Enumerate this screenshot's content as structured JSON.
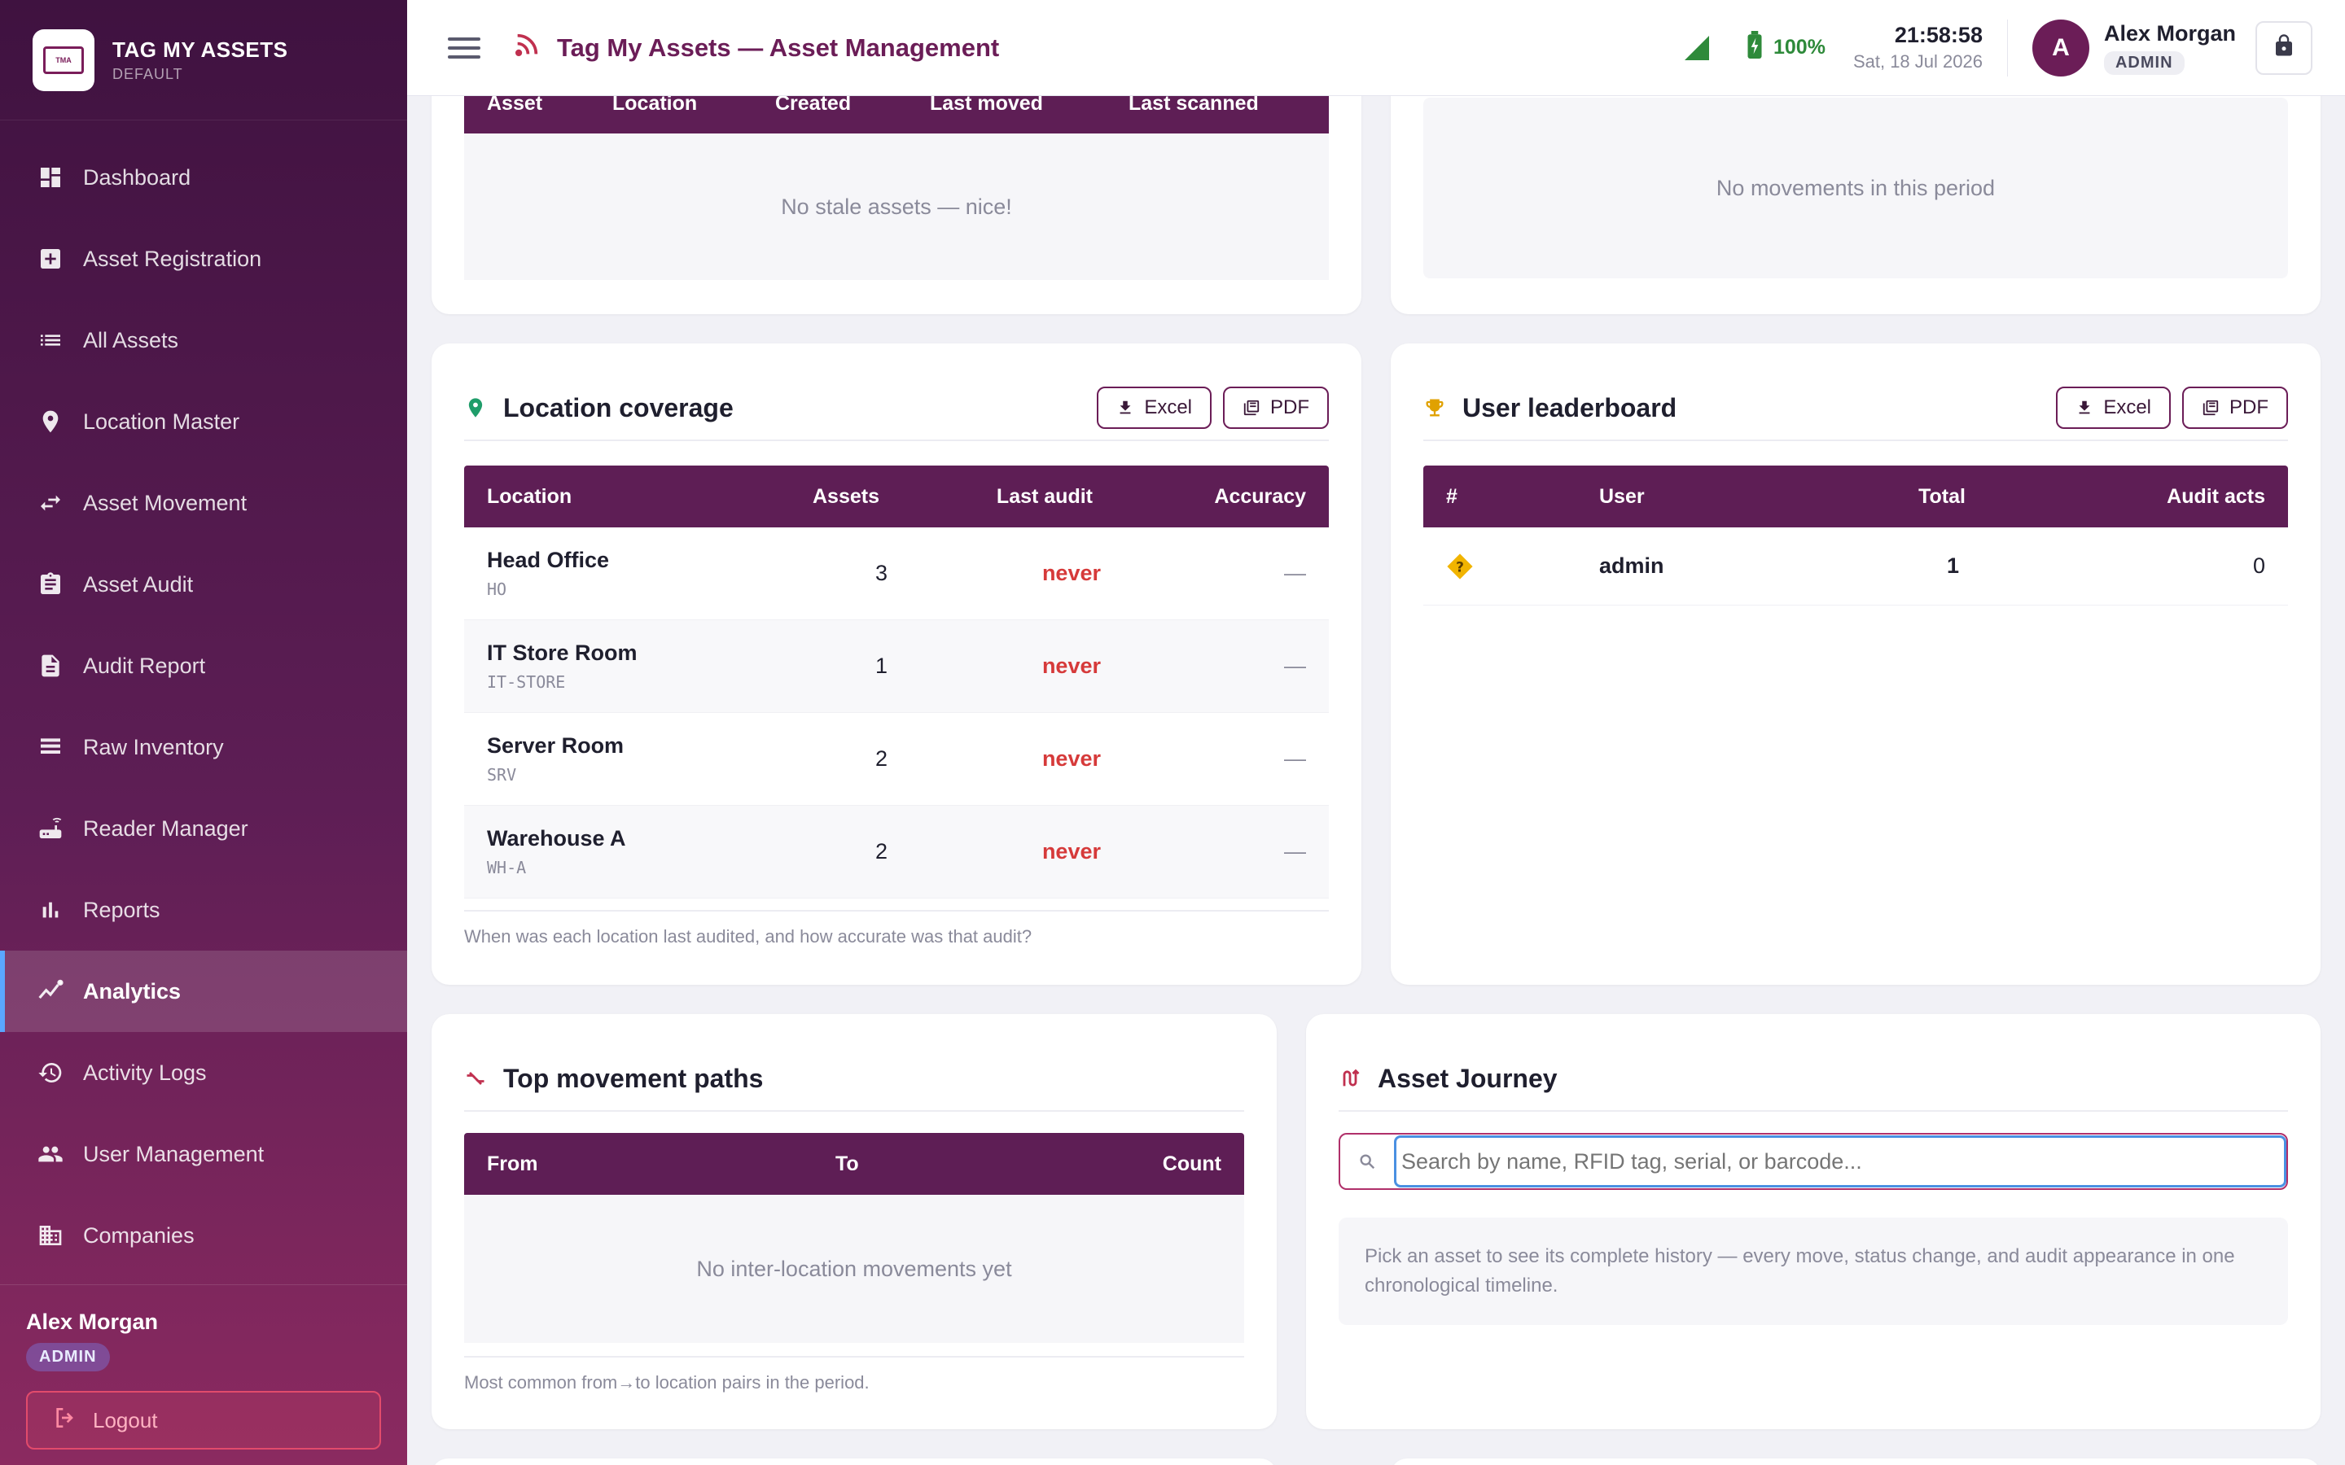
{
  "brand": {
    "name": "TAG MY ASSETS",
    "sub": "DEFAULT",
    "logo_text": "TAG MY ASSETS"
  },
  "nav": [
    {
      "label": "Dashboard",
      "icon": "dashboard-icon"
    },
    {
      "label": "Asset Registration",
      "icon": "add-box-icon"
    },
    {
      "label": "All Assets",
      "icon": "list-icon"
    },
    {
      "label": "Location Master",
      "icon": "location-pin-icon"
    },
    {
      "label": "Asset Movement",
      "icon": "swap-arrows-icon"
    },
    {
      "label": "Asset Audit",
      "icon": "clipboard-icon"
    },
    {
      "label": "Audit Report",
      "icon": "document-icon"
    },
    {
      "label": "Raw Inventory",
      "icon": "list-bars-icon"
    },
    {
      "label": "Reader Manager",
      "icon": "router-icon"
    },
    {
      "label": "Reports",
      "icon": "bar-chart-icon"
    },
    {
      "label": "Analytics",
      "icon": "analytics-icon",
      "active": true
    },
    {
      "label": "Activity Logs",
      "icon": "history-icon"
    },
    {
      "label": "User Management",
      "icon": "people-icon"
    },
    {
      "label": "Companies",
      "icon": "building-icon"
    }
  ],
  "side_user": {
    "name": "Alex Morgan",
    "role": "ADMIN",
    "logout": "Logout"
  },
  "header": {
    "title": "Tag My Assets — Asset Management",
    "battery": "100%",
    "time": "21:58:58",
    "date": "Sat, 18 Jul 2026",
    "user_name": "Alex Morgan",
    "user_role": "ADMIN",
    "avatar_letter": "A"
  },
  "stale_assets": {
    "columns": [
      "Asset",
      "Location",
      "Created",
      "Last moved",
      "Last scanned"
    ],
    "empty": "No stale assets — nice!"
  },
  "movements": {
    "empty": "No movements in this period"
  },
  "location_coverage": {
    "title": "Location coverage",
    "excel": "Excel",
    "pdf": "PDF",
    "columns": [
      "Location",
      "Assets",
      "Last audit",
      "Accuracy"
    ],
    "rows": [
      {
        "name": "Head Office",
        "code": "HO",
        "assets": "3",
        "last_audit": "never",
        "accuracy": "—"
      },
      {
        "name": "IT Store Room",
        "code": "IT-STORE",
        "assets": "1",
        "last_audit": "never",
        "accuracy": "—"
      },
      {
        "name": "Server Room",
        "code": "SRV",
        "assets": "2",
        "last_audit": "never",
        "accuracy": "—"
      },
      {
        "name": "Warehouse A",
        "code": "WH-A",
        "assets": "2",
        "last_audit": "never",
        "accuracy": "—"
      }
    ],
    "note": "When was each location last audited, and how accurate was that audit?"
  },
  "leaderboard": {
    "title": "User leaderboard",
    "excel": "Excel",
    "pdf": "PDF",
    "columns": [
      "#",
      "User",
      "Total",
      "Audit acts"
    ],
    "rows": [
      {
        "rank_icon": "question-diamond-icon",
        "user": "admin",
        "total": "1",
        "audit_acts": "0"
      }
    ]
  },
  "movement_paths": {
    "title": "Top movement paths",
    "columns": [
      "From",
      "To",
      "Count"
    ],
    "empty": "No inter-location movements yet",
    "note": "Most common from→to location pairs in the period."
  },
  "journey": {
    "title": "Asset Journey",
    "placeholder": "Search by name, RFID tag, serial, or barcode...",
    "hint": "Pick an asset to see its complete history — every move, status change, and audit appearance in one chronological timeline."
  },
  "colors": {
    "primary": "#5e1e55",
    "accent": "#6b1d57",
    "danger": "#d63a3a",
    "success": "#2e8a3a"
  }
}
